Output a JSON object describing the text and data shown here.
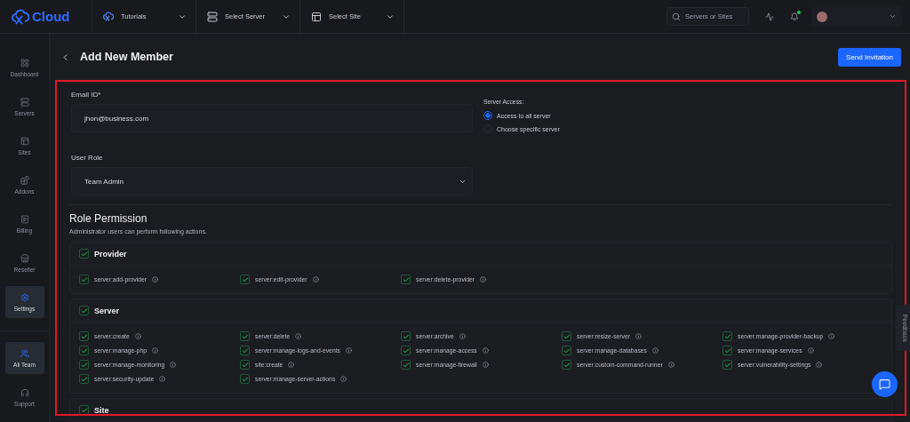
{
  "brand": {
    "name": "Cloud"
  },
  "topbar": {
    "selectors": [
      {
        "label": "Tutorials",
        "kind": "logo"
      },
      {
        "label": "Select Server",
        "kind": "server"
      },
      {
        "label": "Select Site",
        "kind": "site"
      }
    ],
    "search": {
      "placeholder": "Servers or Sites"
    },
    "notification_dot": true
  },
  "sidebar": {
    "items": [
      {
        "label": "Dashboard",
        "kind": "grid",
        "selected": false
      },
      {
        "label": "Servers",
        "kind": "server",
        "selected": false
      },
      {
        "label": "Sites",
        "kind": "site",
        "selected": false
      },
      {
        "label": "Addons",
        "kind": "addons",
        "selected": false
      },
      {
        "label": "Billing",
        "kind": "billing",
        "selected": false
      },
      {
        "label": "Reseller",
        "kind": "reseller",
        "selected": false
      },
      {
        "label": "Settings",
        "kind": "settings",
        "selected": true
      }
    ],
    "bottom_items": [
      {
        "label": "All Team",
        "kind": "team",
        "selected": true
      },
      {
        "label": "Support",
        "kind": "support",
        "selected": false
      }
    ]
  },
  "page": {
    "title": "Add New Member",
    "send_button": "Send Invitation"
  },
  "form": {
    "email": {
      "label": "Email ID*",
      "value": "jhon@business.com"
    },
    "server_access": {
      "label": "Server Access:",
      "options": [
        {
          "label": "Access to all server",
          "selected": true
        },
        {
          "label": "Choose specific server",
          "selected": false
        }
      ]
    },
    "user_role": {
      "label": "User Role",
      "value": "Team Admin"
    }
  },
  "permissions": {
    "title": "Role Permission",
    "description": "Administrator users can perform following actions.",
    "groups": [
      {
        "name": "Provider",
        "checked": true,
        "items": [
          {
            "label": "server:add-provider",
            "checked": true
          },
          {
            "label": "server:edit-provider",
            "checked": true
          },
          {
            "label": "server:delete-provider",
            "checked": true
          }
        ]
      },
      {
        "name": "Server",
        "checked": true,
        "items": [
          {
            "label": "server:create",
            "checked": true
          },
          {
            "label": "server:delete",
            "checked": true
          },
          {
            "label": "server:archive",
            "checked": true
          },
          {
            "label": "server:resize-server",
            "checked": true
          },
          {
            "label": "server:manage-provider-backup",
            "checked": true
          },
          {
            "label": "server:manage-php",
            "checked": true
          },
          {
            "label": "server:manage-logs-and-events",
            "checked": true
          },
          {
            "label": "server:manage-access",
            "checked": true
          },
          {
            "label": "server:manage-databases",
            "checked": true
          },
          {
            "label": "server:manage-services",
            "checked": true
          },
          {
            "label": "server:manage-monitoring",
            "checked": true
          },
          {
            "label": "site:create",
            "checked": true
          },
          {
            "label": "server:manage-firewall",
            "checked": true
          },
          {
            "label": "server:custom-command-runner",
            "checked": true
          },
          {
            "label": "server:vulnerability-settings",
            "checked": true
          },
          {
            "label": "server:security-update",
            "checked": true
          },
          {
            "label": "server:manage-server-actions",
            "checked": true
          }
        ]
      },
      {
        "name": "Site",
        "checked": true
      }
    ]
  },
  "feedback_tab": {
    "label": "Feedback"
  }
}
